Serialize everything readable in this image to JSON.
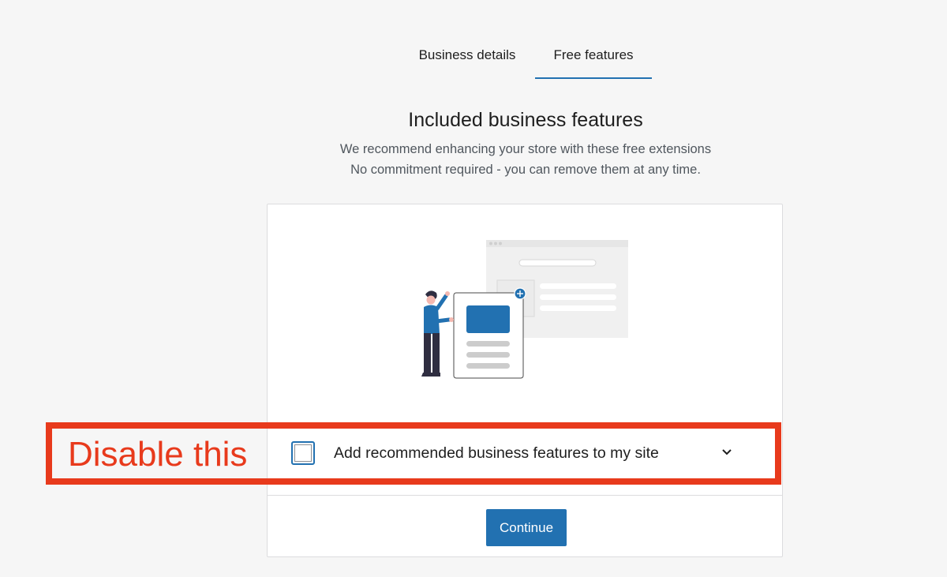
{
  "tabs": [
    {
      "label": "Business details",
      "active": false
    },
    {
      "label": "Free features",
      "active": true
    }
  ],
  "heading": "Included business features",
  "subtitle_lines": [
    "We recommend enhancing your store with these free extensions",
    "No commitment required - you can remove them at any time."
  ],
  "option": {
    "label": "Add recommended business features to my site",
    "checked": false,
    "expand_icon": "chevron-down-icon"
  },
  "continue_label": "Continue",
  "annotation": {
    "text": "Disable this"
  },
  "colors": {
    "accent": "#2271b1",
    "annotation": "#e83a1c",
    "background": "#f6f6f6",
    "card": "#ffffff"
  }
}
